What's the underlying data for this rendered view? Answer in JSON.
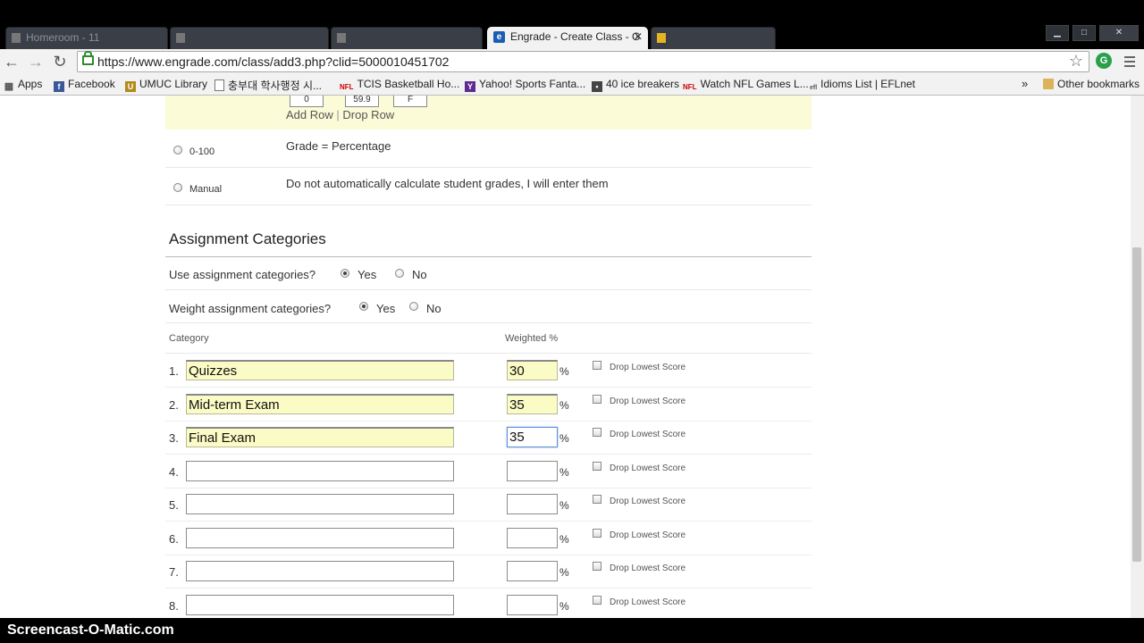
{
  "browser": {
    "tabs": [
      {
        "label": "Homeroom - 11",
        "active": false
      },
      {
        "label": "",
        "active": false
      },
      {
        "label": "",
        "active": false
      },
      {
        "label": "Engrade - Create Class - G",
        "active": true
      },
      {
        "label": "",
        "active": false
      }
    ],
    "url": "https://www.engrade.com/class/add3.php?clid=5000010451702",
    "bookmarks": [
      {
        "label": "Apps",
        "icon": "apps-grid-icon"
      },
      {
        "label": "Facebook",
        "icon": "facebook-icon"
      },
      {
        "label": "UMUC Library",
        "icon": "umuc-icon"
      },
      {
        "label": "충부대 학사행정 시...",
        "icon": "page-icon"
      },
      {
        "label": "TCIS Basketball Ho...",
        "icon": "nfl-icon"
      },
      {
        "label": "Yahoo! Sports Fanta...",
        "icon": "yahoo-icon"
      },
      {
        "label": "40 ice breakers",
        "icon": "site-icon"
      },
      {
        "label": "Watch NFL Games L...",
        "icon": "nfl-icon"
      },
      {
        "label": "Idioms List | EFLnet",
        "icon": "efl-icon"
      }
    ],
    "bookmarks_overflow": "»",
    "other_bookmarks": "Other bookmarks"
  },
  "grading": {
    "mini_values": [
      "0",
      "59.9",
      "F"
    ],
    "add_row": "Add Row",
    "link_sep": "|",
    "drop_row": "Drop Row",
    "options": [
      {
        "label": "0-100",
        "desc": "Grade = Percentage"
      },
      {
        "label": "Manual",
        "desc": "Do not automatically calculate student grades, I will enter them"
      }
    ]
  },
  "categories": {
    "title": "Assignment Categories",
    "use_question": "Use assignment categories?",
    "weight_question": "Weight assignment categories?",
    "yes": "Yes",
    "no": "No",
    "col_category": "Category",
    "col_weighted": "Weighted %",
    "percent_sign": "%",
    "drop_label": "Drop Lowest Score",
    "rows": [
      {
        "num": "1.",
        "name": "Quizzes",
        "weight": "30"
      },
      {
        "num": "2.",
        "name": "Mid-term Exam",
        "weight": "35"
      },
      {
        "num": "3.",
        "name": "Final Exam",
        "weight": "35"
      },
      {
        "num": "4.",
        "name": "",
        "weight": ""
      },
      {
        "num": "5.",
        "name": "",
        "weight": ""
      },
      {
        "num": "6.",
        "name": "",
        "weight": ""
      },
      {
        "num": "7.",
        "name": "",
        "weight": ""
      },
      {
        "num": "8.",
        "name": "",
        "weight": ""
      }
    ]
  },
  "overlay": {
    "watermark": "Screencast-O-Matic.com"
  }
}
